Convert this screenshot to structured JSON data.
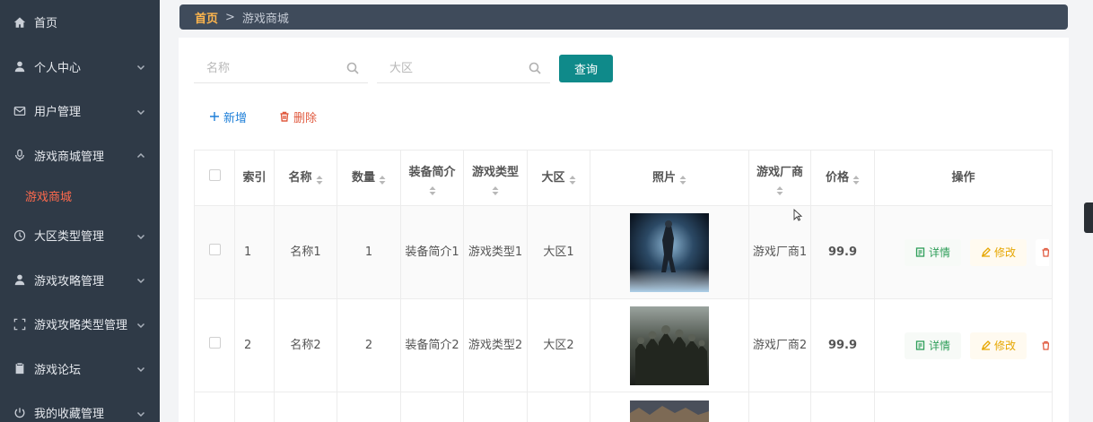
{
  "sidebar": {
    "items": [
      {
        "label": "首页",
        "icon": "home-icon",
        "chevron": false
      },
      {
        "label": "个人中心",
        "icon": "user-icon",
        "chevron": "down"
      },
      {
        "label": "用户管理",
        "icon": "mail-icon",
        "chevron": "down"
      },
      {
        "label": "游戏商城管理",
        "icon": "microphone-icon",
        "chevron": "up"
      },
      {
        "label": "游戏商城",
        "icon": "",
        "chevron": false,
        "active": true
      },
      {
        "label": "大区类型管理",
        "icon": "clock-icon",
        "chevron": "down"
      },
      {
        "label": "游戏攻略管理",
        "icon": "user-icon",
        "chevron": "down"
      },
      {
        "label": "游戏攻略类型管理",
        "icon": "fullscreen-icon",
        "chevron": "down"
      },
      {
        "label": "游戏论坛",
        "icon": "clipboard-icon",
        "chevron": "down"
      },
      {
        "label": "我的收藏管理",
        "icon": "power-icon",
        "chevron": "down"
      }
    ]
  },
  "breadcrumb": {
    "home": "首页",
    "separator": ">",
    "current": "游戏商城"
  },
  "search": {
    "name_placeholder": "名称",
    "region_placeholder": "大区",
    "query_label": "查询"
  },
  "actions": {
    "add_label": "新增",
    "delete_label": "删除"
  },
  "table": {
    "headers": {
      "index": "索引",
      "name": "名称",
      "quantity": "数量",
      "equip": "装备简介",
      "game_type": "游戏类型",
      "region": "大区",
      "photo": "照片",
      "vendor": "游戏厂商",
      "price": "价格",
      "ops": "操作"
    },
    "rows": [
      {
        "index": "1",
        "name": "名称1",
        "quantity": "1",
        "equip": "装备简介1",
        "game_type": "游戏类型1",
        "region": "大区1",
        "vendor": "游戏厂商1",
        "price": "99.9"
      },
      {
        "index": "2",
        "name": "名称2",
        "quantity": "2",
        "equip": "装备简介2",
        "game_type": "游戏类型2",
        "region": "大区2",
        "vendor": "游戏厂商2",
        "price": "99.9"
      }
    ],
    "op_labels": {
      "detail": "详情",
      "edit": "修改"
    }
  },
  "colors": {
    "sidebar_bg": "#2f3a47",
    "active_menu": "#ff6a4d",
    "breadcrumb_bg": "#3f4b5b",
    "breadcrumb_home": "#ffb64d",
    "query_button": "#0f8a8a",
    "add_link": "#1e7fd8",
    "delete_link": "#e05a3f",
    "detail_op": "#2e9e59",
    "edit_op": "#e6a600"
  }
}
